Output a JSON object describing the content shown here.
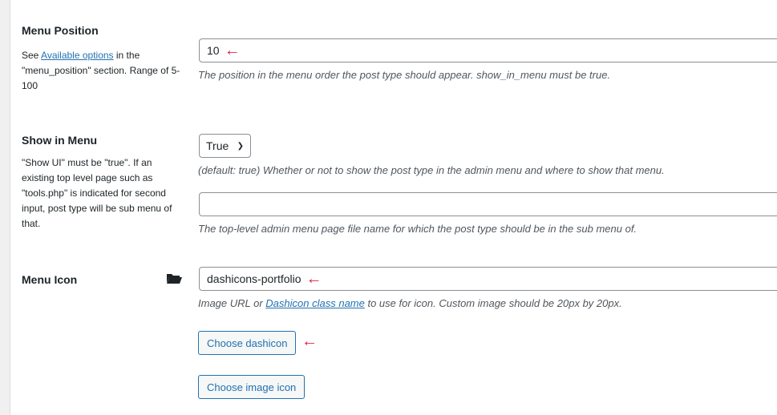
{
  "menu_position": {
    "label": "Menu Position",
    "help_pre": "See ",
    "help_link": "Available options",
    "help_post": " in the \"menu_position\" section. Range of 5-100",
    "value": "10",
    "description": "The position in the menu order the post type should appear. show_in_menu must be true."
  },
  "show_in_menu": {
    "label": "Show in Menu",
    "help": "\"Show UI\" must be \"true\". If an existing top level page such as \"tools.php\" is indicated for second input, post type will be sub menu of that.",
    "select_value": "True",
    "select_description": "(default: true) Whether or not to show the post type in the admin menu and where to show that menu.",
    "submenu_value": "",
    "submenu_description": "The top-level admin menu page file name for which the post type should be in the sub menu of."
  },
  "menu_icon": {
    "label": "Menu Icon",
    "icon": "folder-open-icon",
    "value": "dashicons-portfolio",
    "desc_pre": "Image URL or ",
    "desc_link": "Dashicon class name",
    "desc_post": " to use for icon. Custom image should be 20px by 20px.",
    "choose_dashicon": "Choose dashicon",
    "choose_image": "Choose image icon"
  },
  "annotation_arrow": "←",
  "colors": {
    "arrow": "#e0224c",
    "link": "#2271b1"
  }
}
